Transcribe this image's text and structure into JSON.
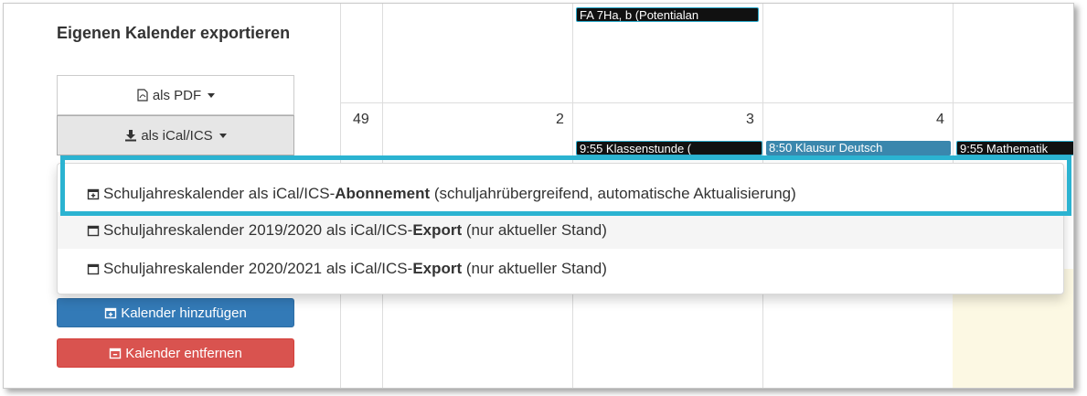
{
  "sidebar": {
    "export_title": "Eigenen Kalender exportieren",
    "pdf_button": "als PDF",
    "ical_button": "als iCal/ICS",
    "add_calendar_button": "Kalender hinzufügen",
    "remove_calendar_button": "Kalender entfernen"
  },
  "dropdown": {
    "items": [
      {
        "prefix": "Schuljahreskalender als iCal/ICS-",
        "bold": "Abonnement",
        "suffix": " (schuljahrübergreifend, automatische Aktualisierung)"
      },
      {
        "prefix": "Schuljahreskalender 2019/2020 als iCal/ICS-",
        "bold": "Export",
        "suffix": " (nur aktueller Stand)"
      },
      {
        "prefix": "Schuljahreskalender 2020/2021 als iCal/ICS-",
        "bold": "Export",
        "suffix": " (nur aktueller Stand)"
      }
    ]
  },
  "calendar": {
    "week_number": "49",
    "days": [
      "2",
      "3",
      "4"
    ],
    "events": {
      "top_partial": "FA 7Ha, b (Potentialan",
      "klassenstunde": "9:55 Klassenstunde (",
      "klausur": "8:50 Klausur Deutsch",
      "mathematik": "9:55 Mathematik"
    }
  },
  "colors": {
    "highlight": "#2bb3d1",
    "primary": "#337ab7",
    "danger": "#d9534f",
    "success": "#5cb85c",
    "today": "#fcf8e3"
  }
}
